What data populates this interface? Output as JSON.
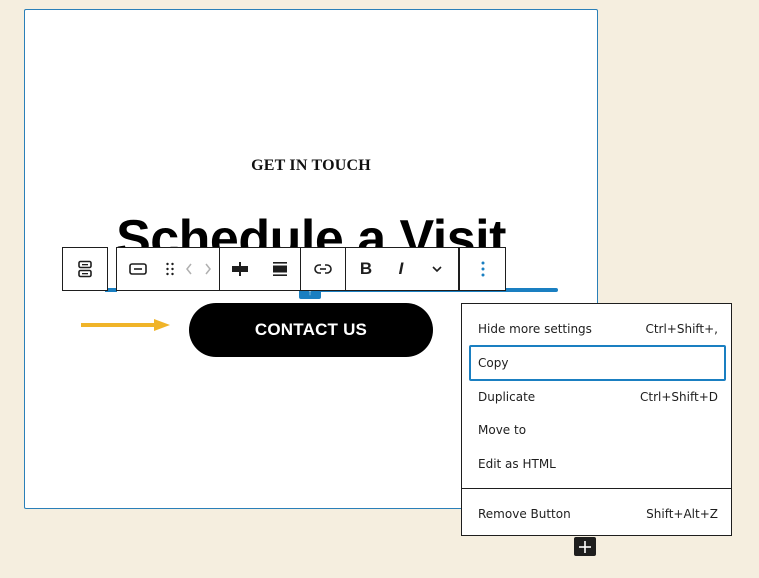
{
  "canvas": {
    "eyebrow": "GET IN TOUCH",
    "heading": "Schedule a Visit",
    "button_label": "CONTACT US"
  },
  "colors": {
    "accent": "#1a7fc1",
    "background": "#f5eedf",
    "arrow": "#f0b429",
    "button_bg": "#000000"
  },
  "toolbar": {
    "groups": [
      {
        "items": [
          {
            "icon": "buttons-parent-icon",
            "label": "Select parent block: Buttons"
          }
        ]
      },
      {
        "items": [
          {
            "icon": "button-block-icon",
            "label": "Button"
          },
          {
            "icon": "drag-handle-icon",
            "label": "Drag"
          },
          {
            "icon": "move-left-icon",
            "label": "Move left"
          },
          {
            "icon": "move-right-icon",
            "label": "Move right"
          }
        ]
      },
      {
        "items": [
          {
            "icon": "justify-center-icon",
            "label": "Change items justification"
          },
          {
            "icon": "width-icon",
            "label": "Button width"
          }
        ]
      },
      {
        "items": [
          {
            "icon": "link-icon",
            "label": "Link"
          }
        ]
      },
      {
        "items": [
          {
            "icon": "bold-icon",
            "label": "Bold",
            "glyph": "B"
          },
          {
            "icon": "italic-icon",
            "label": "Italic",
            "glyph": "I"
          },
          {
            "icon": "chevron-down-icon",
            "label": "More"
          }
        ]
      },
      {
        "items": [
          {
            "icon": "more-vertical-icon",
            "label": "Options"
          }
        ]
      }
    ]
  },
  "menu": {
    "items": [
      {
        "label": "Hide more settings",
        "shortcut": "Ctrl+Shift+,"
      },
      {
        "label": "Copy",
        "shortcut": "",
        "focused": true
      },
      {
        "label": "Duplicate",
        "shortcut": "Ctrl+Shift+D"
      },
      {
        "label": "Move to",
        "shortcut": ""
      },
      {
        "label": "Edit as HTML",
        "shortcut": ""
      }
    ],
    "danger": {
      "label": "Remove Button",
      "shortcut": "Shift+Alt+Z"
    }
  },
  "inserter": {
    "icon": "plus-icon",
    "label": "+"
  }
}
